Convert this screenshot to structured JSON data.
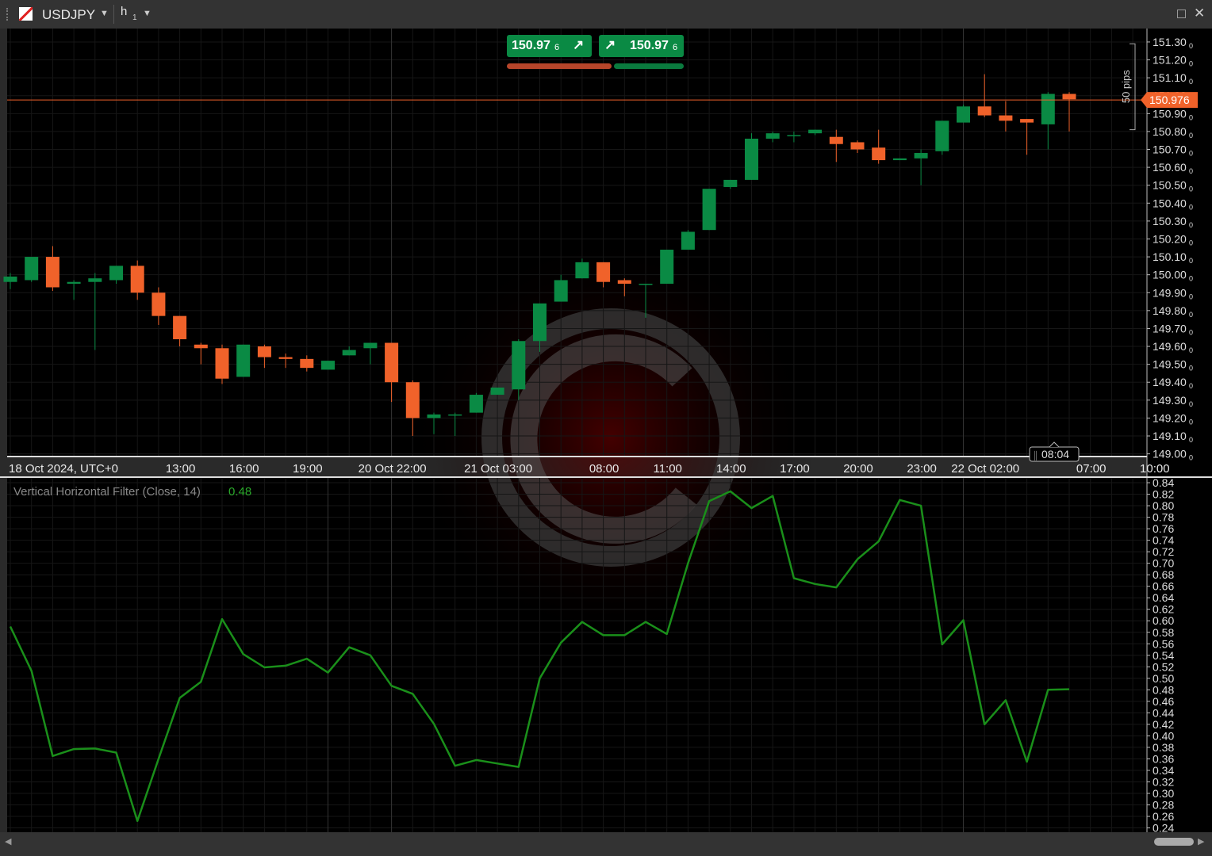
{
  "window": {
    "symbol": "USDJPY",
    "timeframe_letter": "h",
    "timeframe_number": "1"
  },
  "quotes": {
    "sell_price": "150.97",
    "sell_pipette": "6",
    "buy_price": "150.97",
    "buy_pipette": "6"
  },
  "colors": {
    "background": "#000000",
    "bull": "#0a8a44",
    "bear": "#f0622a",
    "indicator_line": "#1a8f1a",
    "price_line": "#f0622a"
  },
  "icons": {
    "symbol": "currency-flag-icon",
    "sell_arrow": "arrow-up-right-icon",
    "buy_arrow": "arrow-up-right-icon",
    "popout": "popout-icon",
    "close": "close-icon"
  },
  "chart_data": [
    {
      "type": "candlestick",
      "symbol": "USDJPY",
      "timeframe": "h1",
      "x_ticks": [
        "18 Oct 2024, UTC+0",
        "13:00",
        "16:00",
        "19:00",
        "20 Oct 22:00",
        "21 Oct 03:00",
        "08:00",
        "11:00",
        "14:00",
        "17:00",
        "20:00",
        "23:00",
        "22 Oct 02:00",
        "07:00",
        "10:00"
      ],
      "y_ticks": [
        "151.30",
        "151.20",
        "151.10",
        "151.00",
        "150.90",
        "150.80",
        "150.70",
        "150.60",
        "150.50",
        "150.40",
        "150.30",
        "150.20",
        "150.10",
        "150.00",
        "149.90",
        "149.80",
        "149.70",
        "149.60",
        "149.50",
        "149.40",
        "149.30",
        "149.20",
        "149.10",
        "149.00"
      ],
      "y_tick_suffix": "0",
      "ylim": [
        148.985,
        151.375
      ],
      "current_price": "150.976",
      "current_price_value": 150.976,
      "time_marker": "08:04",
      "pips_label": "50 pips",
      "candles": [
        {
          "o": 149.96,
          "h": 150.01,
          "l": 149.92,
          "c": 149.99
        },
        {
          "o": 149.97,
          "h": 150.1,
          "l": 149.96,
          "c": 150.1
        },
        {
          "o": 150.1,
          "h": 150.16,
          "l": 149.91,
          "c": 149.93
        },
        {
          "o": 149.95,
          "h": 149.97,
          "l": 149.86,
          "c": 149.96
        },
        {
          "o": 149.96,
          "h": 150.01,
          "l": 149.58,
          "c": 149.98
        },
        {
          "o": 149.97,
          "h": 150.05,
          "l": 149.95,
          "c": 150.05
        },
        {
          "o": 150.05,
          "h": 150.08,
          "l": 149.86,
          "c": 149.9
        },
        {
          "o": 149.9,
          "h": 149.93,
          "l": 149.72,
          "c": 149.77
        },
        {
          "o": 149.77,
          "h": 149.77,
          "l": 149.6,
          "c": 149.64
        },
        {
          "o": 149.61,
          "h": 149.62,
          "l": 149.5,
          "c": 149.59
        },
        {
          "o": 149.59,
          "h": 149.61,
          "l": 149.39,
          "c": 149.42
        },
        {
          "o": 149.43,
          "h": 149.61,
          "l": 149.43,
          "c": 149.61
        },
        {
          "o": 149.6,
          "h": 149.61,
          "l": 149.48,
          "c": 149.54
        },
        {
          "o": 149.54,
          "h": 149.56,
          "l": 149.48,
          "c": 149.53
        },
        {
          "o": 149.53,
          "h": 149.55,
          "l": 149.46,
          "c": 149.48
        },
        {
          "o": 149.47,
          "h": 149.52,
          "l": 149.47,
          "c": 149.52
        },
        {
          "o": 149.55,
          "h": 149.6,
          "l": 149.55,
          "c": 149.58
        },
        {
          "o": 149.59,
          "h": 149.62,
          "l": 149.5,
          "c": 149.62
        },
        {
          "o": 149.62,
          "h": 149.62,
          "l": 149.29,
          "c": 149.4
        },
        {
          "o": 149.4,
          "h": 149.41,
          "l": 149.1,
          "c": 149.2
        },
        {
          "o": 149.2,
          "h": 149.23,
          "l": 149.11,
          "c": 149.22
        },
        {
          "o": 149.22,
          "h": 149.23,
          "l": 149.1,
          "c": 149.22
        },
        {
          "o": 149.23,
          "h": 149.34,
          "l": 149.23,
          "c": 149.33
        },
        {
          "o": 149.33,
          "h": 149.37,
          "l": 149.33,
          "c": 149.37
        },
        {
          "o": 149.36,
          "h": 149.64,
          "l": 149.3,
          "c": 149.63
        },
        {
          "o": 149.63,
          "h": 149.84,
          "l": 149.57,
          "c": 149.84
        },
        {
          "o": 149.85,
          "h": 150.0,
          "l": 149.85,
          "c": 149.97
        },
        {
          "o": 149.98,
          "h": 150.09,
          "l": 149.98,
          "c": 150.07
        },
        {
          "o": 150.07,
          "h": 150.07,
          "l": 149.93,
          "c": 149.96
        },
        {
          "o": 149.97,
          "h": 149.98,
          "l": 149.88,
          "c": 149.95
        },
        {
          "o": 149.95,
          "h": 149.95,
          "l": 149.76,
          "c": 149.95
        },
        {
          "o": 149.95,
          "h": 150.14,
          "l": 149.95,
          "c": 150.14
        },
        {
          "o": 150.14,
          "h": 150.25,
          "l": 150.14,
          "c": 150.24
        },
        {
          "o": 150.25,
          "h": 150.48,
          "l": 150.25,
          "c": 150.48
        },
        {
          "o": 150.49,
          "h": 150.53,
          "l": 150.48,
          "c": 150.53
        },
        {
          "o": 150.53,
          "h": 150.79,
          "l": 150.53,
          "c": 150.76
        },
        {
          "o": 150.76,
          "h": 150.8,
          "l": 150.74,
          "c": 150.79
        },
        {
          "o": 150.78,
          "h": 150.8,
          "l": 150.74,
          "c": 150.78
        },
        {
          "o": 150.79,
          "h": 150.81,
          "l": 150.78,
          "c": 150.81
        },
        {
          "o": 150.77,
          "h": 150.81,
          "l": 150.63,
          "c": 150.73
        },
        {
          "o": 150.74,
          "h": 150.75,
          "l": 150.68,
          "c": 150.7
        },
        {
          "o": 150.71,
          "h": 150.81,
          "l": 150.62,
          "c": 150.64
        },
        {
          "o": 150.64,
          "h": 150.65,
          "l": 150.64,
          "c": 150.65
        },
        {
          "o": 150.65,
          "h": 150.7,
          "l": 150.5,
          "c": 150.68
        },
        {
          "o": 150.69,
          "h": 150.86,
          "l": 150.67,
          "c": 150.86
        },
        {
          "o": 150.85,
          "h": 150.95,
          "l": 150.85,
          "c": 150.94
        },
        {
          "o": 150.94,
          "h": 151.12,
          "l": 150.88,
          "c": 150.89
        },
        {
          "o": 150.89,
          "h": 150.97,
          "l": 150.8,
          "c": 150.86
        },
        {
          "o": 150.87,
          "h": 150.87,
          "l": 150.67,
          "c": 150.85
        },
        {
          "o": 150.84,
          "h": 151.02,
          "l": 150.7,
          "c": 151.01
        },
        {
          "o": 151.01,
          "h": 151.02,
          "l": 150.8,
          "c": 150.98
        }
      ]
    },
    {
      "type": "line",
      "title": "Vertical Horizontal Filter (Close, 14)",
      "last_value": "0.48",
      "y_ticks": [
        "0.84",
        "0.82",
        "0.80",
        "0.78",
        "0.76",
        "0.74",
        "0.72",
        "0.70",
        "0.68",
        "0.66",
        "0.64",
        "0.62",
        "0.60",
        "0.58",
        "0.56",
        "0.54",
        "0.52",
        "0.50",
        "0.48",
        "0.46",
        "0.44",
        "0.42",
        "0.40",
        "0.38",
        "0.36",
        "0.34",
        "0.32",
        "0.30",
        "0.28",
        "0.26",
        "0.24"
      ],
      "ylim": [
        0.2325,
        0.8483
      ],
      "series": [
        {
          "values": [
            0.59,
            0.513,
            0.365,
            0.377,
            0.378,
            0.371,
            0.252,
            0.36,
            0.466,
            0.494,
            0.603,
            0.542,
            0.519,
            0.522,
            0.534,
            0.51,
            0.554,
            0.54,
            0.487,
            0.473,
            0.421,
            0.348,
            0.358,
            0.352,
            0.346,
            0.5,
            0.562,
            0.598,
            0.575,
            0.575,
            0.598,
            0.577,
            0.7,
            0.808,
            0.825,
            0.796,
            0.817,
            0.674,
            0.664,
            0.658,
            0.707,
            0.738,
            0.81,
            0.8,
            0.559,
            0.601,
            0.42,
            0.462,
            0.355,
            0.48,
            0.481
          ]
        }
      ]
    }
  ]
}
